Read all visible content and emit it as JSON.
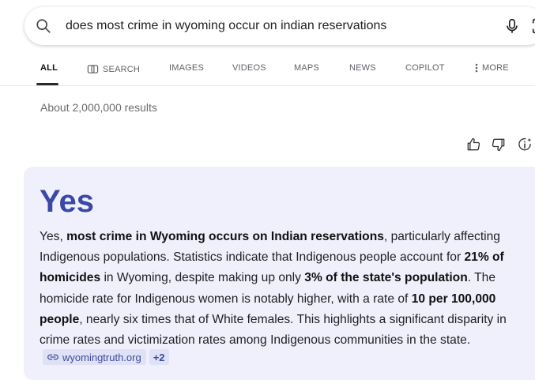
{
  "search": {
    "query": "does most crime in wyoming occur on indian reservations"
  },
  "tabs": [
    {
      "label": "ALL"
    },
    {
      "label": "SEARCH"
    },
    {
      "label": "IMAGES"
    },
    {
      "label": "VIDEOS"
    },
    {
      "label": "MAPS"
    },
    {
      "label": "NEWS"
    },
    {
      "label": "COPILOT"
    },
    {
      "label": "MORE"
    }
  ],
  "results_count": "About 2,000,000 results",
  "answer": {
    "title": "Yes",
    "segments": [
      {
        "text": "Yes, ",
        "bold": false
      },
      {
        "text": "most crime in Wyoming occurs on Indian reservations",
        "bold": true
      },
      {
        "text": ", particularly affecting Indigenous populations. Statistics indicate that Indigenous people account for ",
        "bold": false
      },
      {
        "text": "21% of homicides",
        "bold": true
      },
      {
        "text": " in Wyoming, despite making up only ",
        "bold": false
      },
      {
        "text": "3% of the state's population",
        "bold": true
      },
      {
        "text": ". The homicide rate for Indigenous women is notably higher, with a rate of ",
        "bold": false
      },
      {
        "text": "10 per 100,000 people",
        "bold": true
      },
      {
        "text": ", nearly six times that of White females. This highlights a significant disparity in crime rates and victimization rates among Indigenous communities in the state.",
        "bold": false
      }
    ],
    "citation": {
      "source": "wyomingtruth.org",
      "more": "+2"
    }
  },
  "colors": {
    "accent": "#3a48a6",
    "card_background": "#eff0fc",
    "chip_background": "#dfe2f6"
  },
  "icons": [
    "search-icon",
    "microphone-icon",
    "visual-search-icon",
    "copilot-icon",
    "more-dots-icon",
    "thumbs-up-icon",
    "thumbs-down-icon",
    "info-icon",
    "link-icon"
  ]
}
